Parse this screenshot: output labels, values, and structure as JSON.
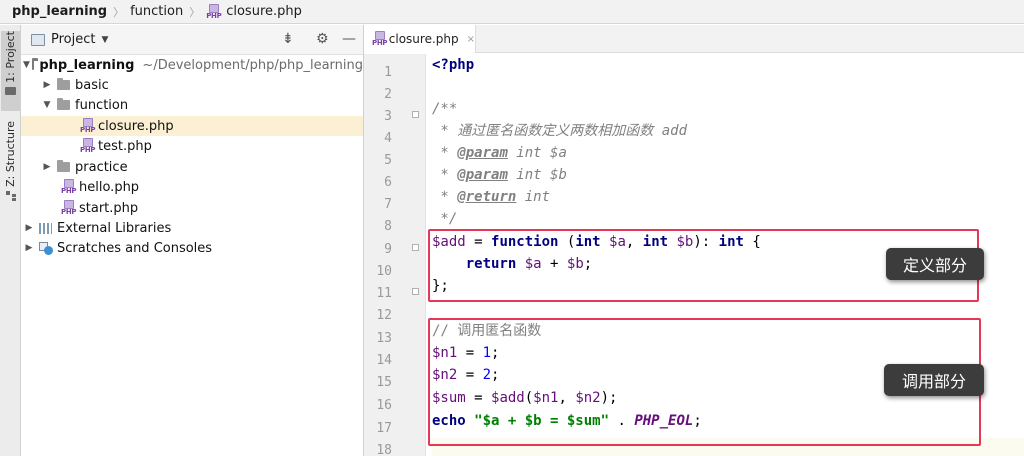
{
  "breadcrumb": {
    "project": "php_learning",
    "folder": "function",
    "file": "closure.php"
  },
  "side_strip": {
    "project_tab": "1: Project",
    "structure_tab": "Z: Structure"
  },
  "project_panel": {
    "title": "Project"
  },
  "tree": {
    "root": {
      "name": "php_learning",
      "path": "~/Development/php/php_learning"
    },
    "basic": "basic",
    "function": "function",
    "closure": "closure.php",
    "test": "test.php",
    "practice": "practice",
    "hello": "hello.php",
    "start": "start.php",
    "external_libraries": "External Libraries",
    "scratches": "Scratches and Consoles"
  },
  "editor": {
    "tab": "closure.php",
    "line_numbers": [
      "1",
      "2",
      "3",
      "4",
      "5",
      "6",
      "7",
      "8",
      "9",
      "10",
      "11",
      "12",
      "13",
      "14",
      "15",
      "16",
      "17",
      "18"
    ],
    "code": {
      "l1": "<?php",
      "l3": "/**",
      "l4_pre": " * 通过匿名函数定义两数相加函数 ",
      "l4_name": "add",
      "l5_star": " * ",
      "l5_tag": "@param",
      "l5_rest": " int $a",
      "l6_star": " * ",
      "l6_tag": "@param",
      "l6_rest": " int $b",
      "l7_star": " * ",
      "l7_tag": "@return",
      "l7_rest": " int",
      "l8": " */",
      "l9_var": "$add",
      "l9_eq": " = ",
      "l9_fn": "function",
      "l9_open": " (",
      "l9_int1": "int",
      "l9_a": " $a",
      "l9_comma": ", ",
      "l9_int2": "int",
      "l9_b": " $b",
      "l9_close": "): ",
      "l9_int3": "int",
      "l9_brace": " {",
      "l10_ind": "    ",
      "l10_ret": "return",
      "l10_a": " $a",
      "l10_plus": " + ",
      "l10_b": "$b",
      "l10_semi": ";",
      "l11": "};",
      "l13": "// 调用匿名函数",
      "l14_var": "$n1",
      "l14_eq": " = ",
      "l14_num": "1",
      "l14_semi": ";",
      "l15_var": "$n2",
      "l15_eq": " = ",
      "l15_num": "2",
      "l15_semi": ";",
      "l16_var": "$sum",
      "l16_eq": " = ",
      "l16_fn": "$add",
      "l16_open": "(",
      "l16_a": "$n1",
      "l16_comma": ", ",
      "l16_b": "$n2",
      "l16_close": ");",
      "l17_echo": "echo",
      "l17_sp": " ",
      "l17_str": "\"$a + $b = $sum\"",
      "l17_dot": " . ",
      "l17_const": "PHP_EOL",
      "l17_semi": ";"
    }
  },
  "annotations": {
    "define": "定义部分",
    "call": "调用部分",
    "box_color": "#e53758"
  }
}
